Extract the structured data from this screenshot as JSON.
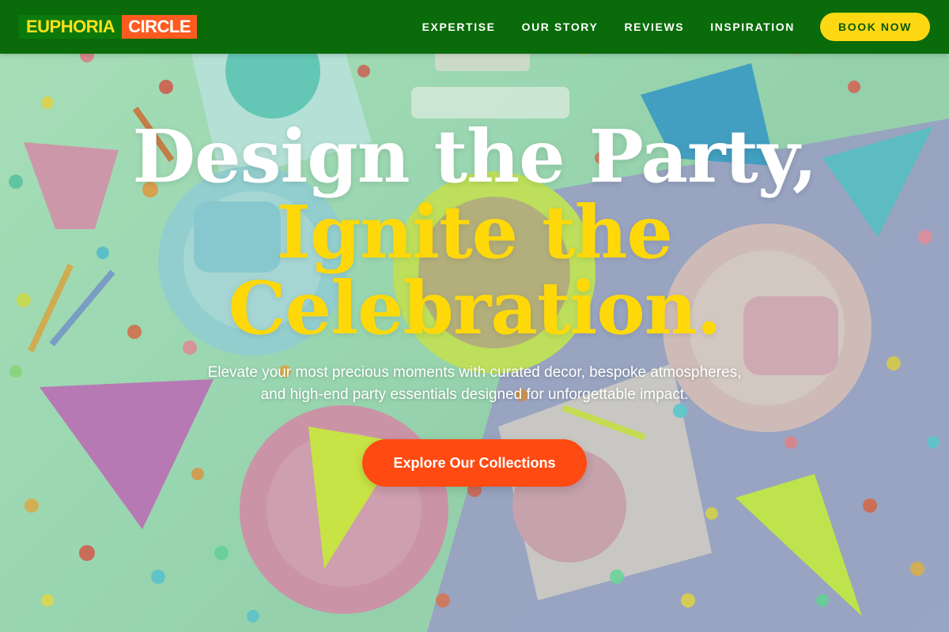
{
  "brand": {
    "part1": "EUPHORIA",
    "part2": "CIRCLE"
  },
  "nav": {
    "links": [
      "EXPERTISE",
      "OUR STORY",
      "REVIEWS",
      "INSPIRATION"
    ],
    "cta_label": "BOOK NOW"
  },
  "hero": {
    "headline_line1": "Design the Party,",
    "headline_line2": "Ignite the",
    "headline_line3": "Celebration.",
    "subtitle": "Elevate your most precious moments with curated decor, bespoke atmospheres, and high-end party essentials designed for unforgettable impact.",
    "cta_label": "Explore Our Collections",
    "background_image": "party-table-scene"
  },
  "colors": {
    "nav_bg": "#0a6b0a",
    "accent_yellow": "#ffd814",
    "accent_orange": "#ff4a12",
    "headline_white": "#ffffff"
  }
}
